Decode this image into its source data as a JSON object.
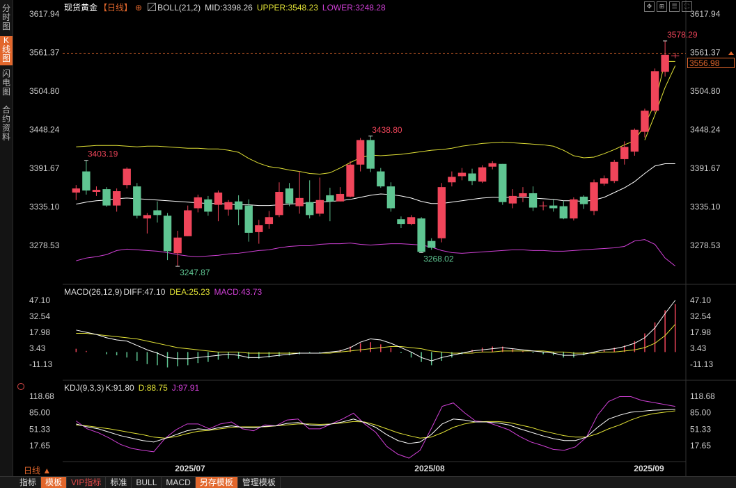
{
  "sidebar": {
    "tabs": [
      {
        "label": "分时图",
        "active": false
      },
      {
        "label": "K线图",
        "active": true
      },
      {
        "label": "闪电图",
        "active": false
      },
      {
        "label": "合约资料",
        "active": false
      }
    ]
  },
  "header": {
    "instrument": "现货黄金",
    "period_tag": "【日线】",
    "add_icon": "plus-circle-icon",
    "indicator_icon": "boll-icon",
    "boll": "BOLL(21,2)",
    "mid": "MID:3398.26",
    "upper": "UPPER:3548.23",
    "lower": "LOWER:3248.28",
    "tool_icons": [
      "expand-icon",
      "crosshair-icon",
      "list-icon",
      "fullscreen-icon"
    ]
  },
  "colors": {
    "up": "#f0455a",
    "down": "#5fc592",
    "mid": "#ffffff",
    "upper": "#e2e236",
    "lower": "#d040d6",
    "accent": "#e2672c",
    "grid": "#2a2a2a"
  },
  "price_axis": {
    "ticks": [
      "3617.94",
      "3561.37",
      "3504.80",
      "3448.24",
      "3391.67",
      "3335.10",
      "3278.53"
    ],
    "current_price": "3556.98"
  },
  "annotations": {
    "high1": "3403.19",
    "low1": "3247.87",
    "high2": "3438.80",
    "low2": "3268.02",
    "high3": "3578.29"
  },
  "macd": {
    "title": "MACD(26,12,9)",
    "diff": "DIFF:47.10",
    "dea": "DEA:25.23",
    "macd": "MACD:43.73",
    "ticks": [
      "47.10",
      "32.54",
      "17.98",
      "3.43",
      "-11.13"
    ]
  },
  "kdj": {
    "title": "KDJ(9,3,3)",
    "k": "K:91.80",
    "d": "D:88.75",
    "j": "J:97.91",
    "ticks": [
      "118.68",
      "85.00",
      "51.33",
      "17.65"
    ]
  },
  "x_axis": {
    "labels": [
      "2025/07",
      "2025/08",
      "2025/09"
    ]
  },
  "footer": {
    "period": "日线 ▲",
    "tabs": [
      {
        "label": "指标",
        "style": "normal"
      },
      {
        "label": "模板",
        "style": "orange"
      },
      {
        "label": "VIP指标",
        "style": "red"
      },
      {
        "label": "标准",
        "style": "normal"
      },
      {
        "label": "BULL",
        "style": "normal"
      },
      {
        "label": "MACD",
        "style": "normal"
      },
      {
        "label": "另存模板",
        "style": "orange"
      },
      {
        "label": "管理模板",
        "style": "normal"
      }
    ]
  },
  "chart_data": {
    "type": "candlestick",
    "title": "现货黄金",
    "y_range": [
      3222.5,
      3646.2
    ],
    "candles": [
      {
        "o": 3356,
        "c": 3362,
        "h": 3367,
        "l": 3345
      },
      {
        "o": 3387,
        "c": 3359,
        "h": 3403.19,
        "l": 3353
      },
      {
        "o": 3357,
        "c": 3360,
        "h": 3365,
        "l": 3351
      },
      {
        "o": 3361,
        "c": 3337,
        "h": 3364,
        "l": 3335
      },
      {
        "o": 3337,
        "c": 3358,
        "h": 3362,
        "l": 3328
      },
      {
        "o": 3367,
        "c": 3391,
        "h": 3393,
        "l": 3362
      },
      {
        "o": 3365,
        "c": 3322,
        "h": 3370,
        "l": 3318
      },
      {
        "o": 3318,
        "c": 3323,
        "h": 3326,
        "l": 3296
      },
      {
        "o": 3330,
        "c": 3323,
        "h": 3343,
        "l": 3312
      },
      {
        "o": 3322,
        "c": 3270,
        "h": 3326,
        "l": 3257
      },
      {
        "o": 3267,
        "c": 3290,
        "h": 3300,
        "l": 3247.87
      },
      {
        "o": 3292,
        "c": 3330,
        "h": 3337,
        "l": 3292
      },
      {
        "o": 3333,
        "c": 3349,
        "h": 3353,
        "l": 3327
      },
      {
        "o": 3346,
        "c": 3328,
        "h": 3351,
        "l": 3322
      },
      {
        "o": 3338,
        "c": 3356,
        "h": 3359,
        "l": 3314
      },
      {
        "o": 3331,
        "c": 3342,
        "h": 3345,
        "l": 3322
      },
      {
        "o": 3343,
        "c": 3331,
        "h": 3352,
        "l": 3308
      },
      {
        "o": 3337,
        "c": 3297,
        "h": 3346,
        "l": 3284
      },
      {
        "o": 3298,
        "c": 3308,
        "h": 3316,
        "l": 3281
      },
      {
        "o": 3310,
        "c": 3320,
        "h": 3329,
        "l": 3303
      },
      {
        "o": 3323,
        "c": 3357,
        "h": 3371,
        "l": 3320
      },
      {
        "o": 3362,
        "c": 3340,
        "h": 3370,
        "l": 3336
      },
      {
        "o": 3336,
        "c": 3348,
        "h": 3387,
        "l": 3325
      },
      {
        "o": 3342,
        "c": 3323,
        "h": 3374,
        "l": 3318
      },
      {
        "o": 3325,
        "c": 3345,
        "h": 3378,
        "l": 3321
      },
      {
        "o": 3352,
        "c": 3343,
        "h": 3363,
        "l": 3314
      },
      {
        "o": 3343,
        "c": 3354,
        "h": 3364,
        "l": 3343
      },
      {
        "o": 3350,
        "c": 3397,
        "h": 3402,
        "l": 3349
      },
      {
        "o": 3397,
        "c": 3433,
        "h": 3436,
        "l": 3387
      },
      {
        "o": 3433,
        "c": 3391,
        "h": 3438.8,
        "l": 3386
      },
      {
        "o": 3387,
        "c": 3365,
        "h": 3392,
        "l": 3363
      },
      {
        "o": 3365,
        "c": 3333,
        "h": 3371,
        "l": 3328
      },
      {
        "o": 3317,
        "c": 3310,
        "h": 3321,
        "l": 3304
      },
      {
        "o": 3310,
        "c": 3320,
        "h": 3323,
        "l": 3308
      },
      {
        "o": 3318,
        "c": 3269,
        "h": 3320,
        "l": 3268.02
      },
      {
        "o": 3285,
        "c": 3275,
        "h": 3289,
        "l": 3272
      },
      {
        "o": 3289,
        "c": 3364,
        "h": 3370,
        "l": 3283
      },
      {
        "o": 3371,
        "c": 3379,
        "h": 3387,
        "l": 3365
      },
      {
        "o": 3380,
        "c": 3385,
        "h": 3392,
        "l": 3374
      },
      {
        "o": 3384,
        "c": 3373,
        "h": 3391,
        "l": 3367
      },
      {
        "o": 3372,
        "c": 3393,
        "h": 3396,
        "l": 3370
      },
      {
        "o": 3394,
        "c": 3399,
        "h": 3402,
        "l": 3390
      },
      {
        "o": 3398,
        "c": 3342,
        "h": 3398,
        "l": 3338
      },
      {
        "o": 3340,
        "c": 3351,
        "h": 3361,
        "l": 3333
      },
      {
        "o": 3350,
        "c": 3355,
        "h": 3364,
        "l": 3342
      },
      {
        "o": 3355,
        "c": 3334,
        "h": 3365,
        "l": 3329
      },
      {
        "o": 3336,
        "c": 3337,
        "h": 3343,
        "l": 3330
      },
      {
        "o": 3337,
        "c": 3333,
        "h": 3346,
        "l": 3328
      },
      {
        "o": 3336,
        "c": 3318,
        "h": 3344,
        "l": 3317
      },
      {
        "o": 3318,
        "c": 3346,
        "h": 3349,
        "l": 3315
      },
      {
        "o": 3350,
        "c": 3339,
        "h": 3352,
        "l": 3332
      },
      {
        "o": 3329,
        "c": 3371,
        "h": 3375,
        "l": 3323
      },
      {
        "o": 3369,
        "c": 3377,
        "h": 3381,
        "l": 3366
      },
      {
        "o": 3373,
        "c": 3401,
        "h": 3404,
        "l": 3370
      },
      {
        "o": 3405,
        "c": 3423,
        "h": 3431,
        "l": 3397
      },
      {
        "o": 3416,
        "c": 3448,
        "h": 3450,
        "l": 3410
      },
      {
        "o": 3445,
        "c": 3476,
        "h": 3479,
        "l": 3437
      },
      {
        "o": 3476,
        "c": 3534,
        "h": 3538,
        "l": 3473
      },
      {
        "o": 3533,
        "c": 3558,
        "h": 3578.29,
        "l": 3526
      },
      {
        "o": 3557,
        "c": 3557,
        "h": 3561,
        "l": 3553
      }
    ],
    "boll_mid": [
      3339,
      3342,
      3344,
      3345,
      3347,
      3348,
      3347,
      3346,
      3345,
      3344,
      3343,
      3342,
      3341,
      3340,
      3340,
      3339,
      3338,
      3338,
      3337,
      3337,
      3338,
      3339,
      3340,
      3341,
      3342,
      3343,
      3344,
      3346,
      3349,
      3352,
      3354,
      3353,
      3351,
      3348,
      3343,
      3340,
      3340,
      3342,
      3344,
      3346,
      3348,
      3349,
      3349,
      3349,
      3349,
      3348,
      3347,
      3346,
      3344,
      3344,
      3343,
      3345,
      3349,
      3356,
      3363,
      3372,
      3384,
      3395,
      3398.26,
      3398.26
    ],
    "boll_upper": [
      3423,
      3424,
      3425,
      3425,
      3425,
      3424,
      3423,
      3424,
      3424,
      3423,
      3422,
      3421,
      3421,
      3420,
      3420,
      3418,
      3415,
      3406,
      3399,
      3394,
      3392,
      3389,
      3387,
      3384,
      3383,
      3385,
      3392,
      3400,
      3407,
      3411,
      3410,
      3411,
      3412,
      3414,
      3416,
      3418,
      3419,
      3421,
      3424,
      3426,
      3428,
      3429,
      3430,
      3429,
      3428,
      3427,
      3426,
      3424,
      3418,
      3410,
      3407,
      3408,
      3413,
      3419,
      3426,
      3432,
      3455,
      3487,
      3548.23,
      3548.23
    ],
    "boll_lower": [
      3256,
      3260,
      3262,
      3265,
      3271,
      3273,
      3272,
      3271,
      3270,
      3268,
      3265,
      3263,
      3262,
      3263,
      3264,
      3266,
      3267,
      3269,
      3271,
      3272,
      3275,
      3277,
      3278,
      3278,
      3280,
      3281,
      3281,
      3282,
      3280,
      3279,
      3280,
      3281,
      3281,
      3280,
      3279,
      3276,
      3271,
      3268,
      3267,
      3268,
      3269,
      3270,
      3271,
      3272,
      3272,
      3271,
      3271,
      3270,
      3270,
      3271,
      3272,
      3273,
      3274,
      3275,
      3277,
      3285,
      3287,
      3280,
      3260,
      3248.28
    ],
    "ma_short": [
      null,
      null,
      null,
      null,
      null,
      null,
      null,
      null,
      null,
      null,
      null,
      null,
      null,
      null,
      null,
      null,
      null,
      null,
      null,
      null,
      null,
      null,
      null,
      null,
      null,
      null,
      null,
      null,
      null,
      null,
      null,
      null,
      null,
      null,
      null,
      null,
      null,
      null,
      null,
      null,
      null,
      null,
      null,
      null,
      null,
      null,
      null,
      null,
      null,
      null,
      null,
      null,
      null,
      null,
      null,
      null,
      3433,
      3470,
      3510,
      3542
    ],
    "macd_diff": [
      20,
      18,
      16,
      13,
      11,
      10,
      6,
      2,
      -1,
      -5,
      -6,
      -6,
      -5,
      -4,
      -3,
      -2,
      -3,
      -5,
      -5,
      -4,
      -3,
      -2,
      -1,
      -1,
      -1,
      0,
      1,
      4,
      9,
      12,
      11,
      8,
      4,
      0,
      -5,
      -8,
      -5,
      -3,
      -1,
      1,
      2,
      3,
      4,
      3,
      2,
      1,
      0,
      -1,
      -3,
      -3,
      -2,
      0,
      2,
      3,
      5,
      8,
      13,
      22,
      35,
      47.1
    ],
    "macd_dea": [
      17,
      17,
      16,
      15,
      14,
      13,
      12,
      10,
      8,
      6,
      4,
      3,
      2,
      1,
      0,
      0,
      0,
      -1,
      -1,
      -1,
      -1,
      -1,
      -1,
      -1,
      -1,
      -1,
      0,
      1,
      2,
      3,
      4,
      5,
      5,
      4,
      3,
      1,
      0,
      -1,
      -1,
      -1,
      0,
      0,
      1,
      1,
      1,
      1,
      1,
      0,
      0,
      -1,
      -1,
      -1,
      0,
      0,
      1,
      2,
      4,
      8,
      15,
      25.23
    ],
    "macd_hist": [
      3,
      1,
      0,
      -2,
      -3,
      -5,
      -8,
      -11,
      -12,
      -14,
      -13,
      -12,
      -10,
      -9,
      -7,
      -6,
      -6,
      -6,
      -6,
      -5,
      -4,
      -3,
      -2,
      -1,
      -1,
      0,
      2,
      5,
      8,
      9,
      7,
      4,
      -1,
      -5,
      -9,
      -12,
      -8,
      -5,
      -2,
      2,
      4,
      5,
      5,
      3,
      1,
      -1,
      -2,
      -3,
      -5,
      -5,
      -3,
      -1,
      2,
      4,
      6,
      10,
      17,
      27,
      38,
      43.73
    ],
    "kdj_k": [
      62,
      56,
      52,
      45,
      38,
      33,
      28,
      25,
      32,
      40,
      48,
      52,
      50,
      55,
      58,
      55,
      54,
      57,
      58,
      63,
      65,
      60,
      58,
      62,
      66,
      72,
      65,
      55,
      40,
      28,
      22,
      25,
      40,
      62,
      72,
      70,
      66,
      66,
      64,
      60,
      52,
      45,
      38,
      32,
      28,
      28,
      35,
      55,
      72,
      80,
      86,
      88,
      90,
      91,
      91.8
    ],
    "kdj_d": [
      60,
      58,
      55,
      52,
      48,
      44,
      40,
      35,
      33,
      36,
      42,
      47,
      49,
      52,
      55,
      56,
      56,
      56,
      58,
      60,
      62,
      62,
      61,
      62,
      64,
      67,
      66,
      60,
      52,
      44,
      38,
      33,
      35,
      44,
      55,
      62,
      66,
      67,
      67,
      65,
      60,
      55,
      48,
      43,
      38,
      35,
      35,
      42,
      52,
      60,
      70,
      78,
      83,
      86,
      88.75
    ],
    "kdj_j": [
      68,
      52,
      44,
      33,
      20,
      12,
      8,
      5,
      32,
      50,
      62,
      62,
      52,
      62,
      66,
      52,
      48,
      60,
      58,
      70,
      72,
      52,
      52,
      62,
      72,
      84,
      62,
      45,
      16,
      0,
      -8,
      8,
      52,
      98,
      105,
      85,
      68,
      66,
      58,
      50,
      36,
      25,
      18,
      10,
      8,
      15,
      35,
      80,
      108,
      118,
      118,
      110,
      106,
      102,
      97.91
    ]
  }
}
